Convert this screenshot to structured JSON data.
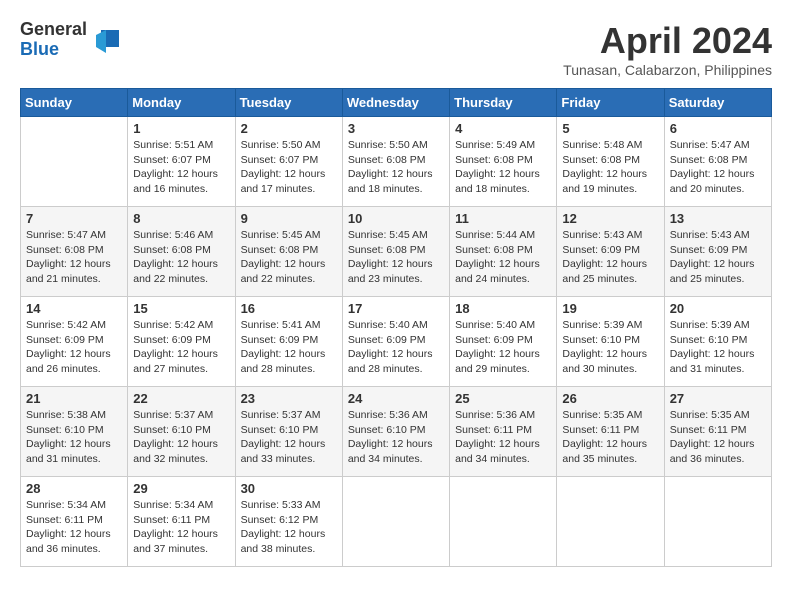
{
  "logo": {
    "general": "General",
    "blue": "Blue"
  },
  "title": "April 2024",
  "location": "Tunasan, Calabarzon, Philippines",
  "weekdays": [
    "Sunday",
    "Monday",
    "Tuesday",
    "Wednesday",
    "Thursday",
    "Friday",
    "Saturday"
  ],
  "weeks": [
    [
      {
        "day": "",
        "info": ""
      },
      {
        "day": "1",
        "info": "Sunrise: 5:51 AM\nSunset: 6:07 PM\nDaylight: 12 hours\nand 16 minutes."
      },
      {
        "day": "2",
        "info": "Sunrise: 5:50 AM\nSunset: 6:07 PM\nDaylight: 12 hours\nand 17 minutes."
      },
      {
        "day": "3",
        "info": "Sunrise: 5:50 AM\nSunset: 6:08 PM\nDaylight: 12 hours\nand 18 minutes."
      },
      {
        "day": "4",
        "info": "Sunrise: 5:49 AM\nSunset: 6:08 PM\nDaylight: 12 hours\nand 18 minutes."
      },
      {
        "day": "5",
        "info": "Sunrise: 5:48 AM\nSunset: 6:08 PM\nDaylight: 12 hours\nand 19 minutes."
      },
      {
        "day": "6",
        "info": "Sunrise: 5:47 AM\nSunset: 6:08 PM\nDaylight: 12 hours\nand 20 minutes."
      }
    ],
    [
      {
        "day": "7",
        "info": "Sunrise: 5:47 AM\nSunset: 6:08 PM\nDaylight: 12 hours\nand 21 minutes."
      },
      {
        "day": "8",
        "info": "Sunrise: 5:46 AM\nSunset: 6:08 PM\nDaylight: 12 hours\nand 22 minutes."
      },
      {
        "day": "9",
        "info": "Sunrise: 5:45 AM\nSunset: 6:08 PM\nDaylight: 12 hours\nand 22 minutes."
      },
      {
        "day": "10",
        "info": "Sunrise: 5:45 AM\nSunset: 6:08 PM\nDaylight: 12 hours\nand 23 minutes."
      },
      {
        "day": "11",
        "info": "Sunrise: 5:44 AM\nSunset: 6:08 PM\nDaylight: 12 hours\nand 24 minutes."
      },
      {
        "day": "12",
        "info": "Sunrise: 5:43 AM\nSunset: 6:09 PM\nDaylight: 12 hours\nand 25 minutes."
      },
      {
        "day": "13",
        "info": "Sunrise: 5:43 AM\nSunset: 6:09 PM\nDaylight: 12 hours\nand 25 minutes."
      }
    ],
    [
      {
        "day": "14",
        "info": "Sunrise: 5:42 AM\nSunset: 6:09 PM\nDaylight: 12 hours\nand 26 minutes."
      },
      {
        "day": "15",
        "info": "Sunrise: 5:42 AM\nSunset: 6:09 PM\nDaylight: 12 hours\nand 27 minutes."
      },
      {
        "day": "16",
        "info": "Sunrise: 5:41 AM\nSunset: 6:09 PM\nDaylight: 12 hours\nand 28 minutes."
      },
      {
        "day": "17",
        "info": "Sunrise: 5:40 AM\nSunset: 6:09 PM\nDaylight: 12 hours\nand 28 minutes."
      },
      {
        "day": "18",
        "info": "Sunrise: 5:40 AM\nSunset: 6:09 PM\nDaylight: 12 hours\nand 29 minutes."
      },
      {
        "day": "19",
        "info": "Sunrise: 5:39 AM\nSunset: 6:10 PM\nDaylight: 12 hours\nand 30 minutes."
      },
      {
        "day": "20",
        "info": "Sunrise: 5:39 AM\nSunset: 6:10 PM\nDaylight: 12 hours\nand 31 minutes."
      }
    ],
    [
      {
        "day": "21",
        "info": "Sunrise: 5:38 AM\nSunset: 6:10 PM\nDaylight: 12 hours\nand 31 minutes."
      },
      {
        "day": "22",
        "info": "Sunrise: 5:37 AM\nSunset: 6:10 PM\nDaylight: 12 hours\nand 32 minutes."
      },
      {
        "day": "23",
        "info": "Sunrise: 5:37 AM\nSunset: 6:10 PM\nDaylight: 12 hours\nand 33 minutes."
      },
      {
        "day": "24",
        "info": "Sunrise: 5:36 AM\nSunset: 6:10 PM\nDaylight: 12 hours\nand 34 minutes."
      },
      {
        "day": "25",
        "info": "Sunrise: 5:36 AM\nSunset: 6:11 PM\nDaylight: 12 hours\nand 34 minutes."
      },
      {
        "day": "26",
        "info": "Sunrise: 5:35 AM\nSunset: 6:11 PM\nDaylight: 12 hours\nand 35 minutes."
      },
      {
        "day": "27",
        "info": "Sunrise: 5:35 AM\nSunset: 6:11 PM\nDaylight: 12 hours\nand 36 minutes."
      }
    ],
    [
      {
        "day": "28",
        "info": "Sunrise: 5:34 AM\nSunset: 6:11 PM\nDaylight: 12 hours\nand 36 minutes."
      },
      {
        "day": "29",
        "info": "Sunrise: 5:34 AM\nSunset: 6:11 PM\nDaylight: 12 hours\nand 37 minutes."
      },
      {
        "day": "30",
        "info": "Sunrise: 5:33 AM\nSunset: 6:12 PM\nDaylight: 12 hours\nand 38 minutes."
      },
      {
        "day": "",
        "info": ""
      },
      {
        "day": "",
        "info": ""
      },
      {
        "day": "",
        "info": ""
      },
      {
        "day": "",
        "info": ""
      }
    ]
  ]
}
